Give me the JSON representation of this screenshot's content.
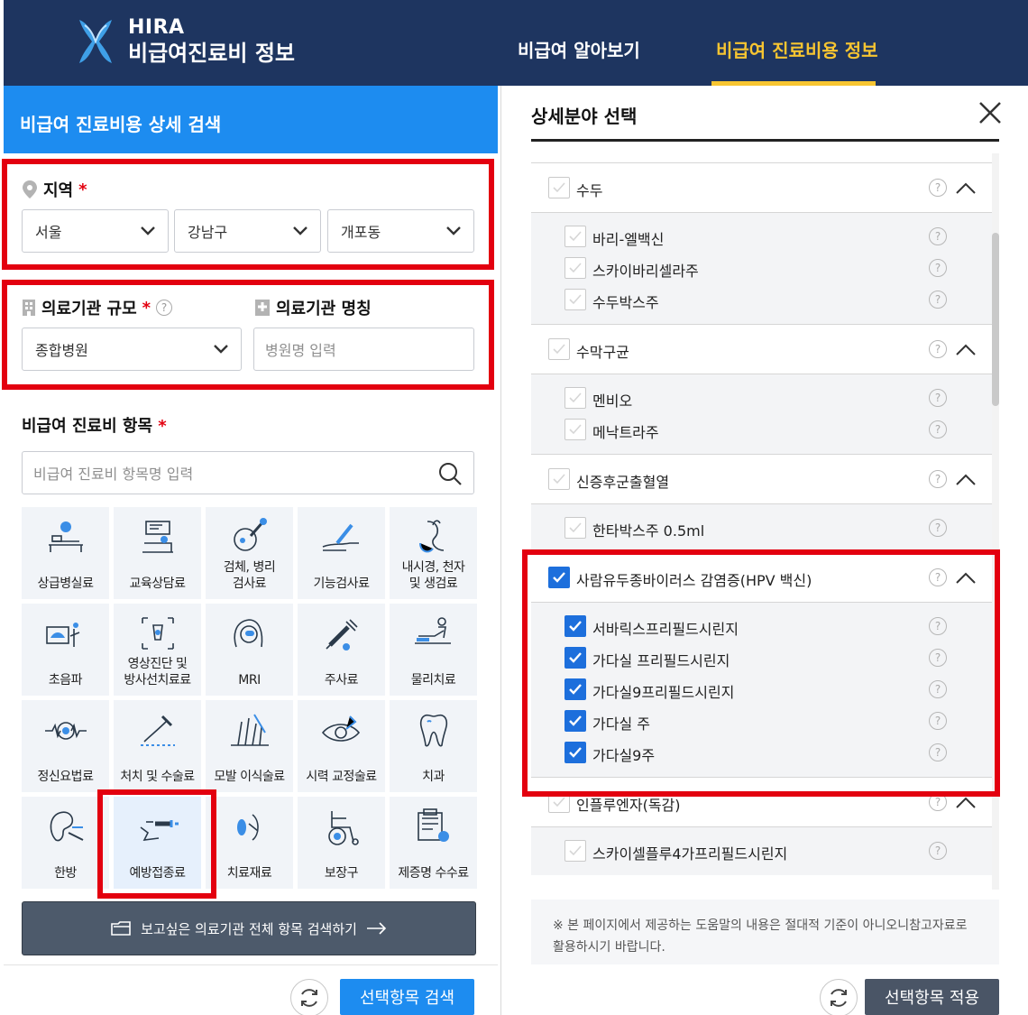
{
  "header": {
    "logo_line1": "HIRA",
    "logo_line2": "비급여진료비 정보",
    "nav": [
      "비급여 알아보기",
      "비급여 진료비용 정보"
    ],
    "bg_color": "#1e3560",
    "active_color": "#f7c531"
  },
  "left": {
    "title": "비급여 진료비용 상세 검색",
    "region": {
      "label": "지역",
      "required": "*",
      "selects": [
        "서울",
        "강남구",
        "개포동"
      ]
    },
    "institution": {
      "size_label": "의료기관 규모",
      "required": "*",
      "size_value": "종합병원",
      "name_label": "의료기관 명칭",
      "name_placeholder": "병원명 입력"
    },
    "items": {
      "label": "비급여 진료비 항목",
      "required": "*",
      "search_placeholder": "비급여 진료비 항목명 입력",
      "tiles": [
        {
          "label": "상급병실료",
          "icon": "hospital-bed-icon"
        },
        {
          "label": "교육상담료",
          "icon": "counseling-icon"
        },
        {
          "label": "검체, 병리\n검사료",
          "icon": "specimen-icon"
        },
        {
          "label": "기능검사료",
          "icon": "function-test-icon"
        },
        {
          "label": "내시경, 천자\n및 생검료",
          "icon": "endoscope-icon"
        },
        {
          "label": "초음파",
          "icon": "ultrasound-icon"
        },
        {
          "label": "영상진단 및\n방사선치료료",
          "icon": "xray-icon"
        },
        {
          "label": "MRI",
          "icon": "mri-icon"
        },
        {
          "label": "주사료",
          "icon": "syringe-icon"
        },
        {
          "label": "물리치료",
          "icon": "physio-icon"
        },
        {
          "label": "정신요법료",
          "icon": "brain-wave-icon"
        },
        {
          "label": "처치 및 수술료",
          "icon": "surgery-icon"
        },
        {
          "label": "모발 이식술료",
          "icon": "hair-transplant-icon"
        },
        {
          "label": "시력 교정술료",
          "icon": "eye-surgery-icon"
        },
        {
          "label": "치과",
          "icon": "tooth-icon"
        },
        {
          "label": "한방",
          "icon": "acupuncture-icon"
        },
        {
          "label": "예방접종료",
          "icon": "vaccine-icon"
        },
        {
          "label": "치료재료",
          "icon": "lens-icon"
        },
        {
          "label": "보장구",
          "icon": "wheelchair-icon"
        },
        {
          "label": "제증명 수수료",
          "icon": "certificate-icon"
        }
      ]
    },
    "full_search_button": "보고싶은 의료기관 전체 항목 검색하기",
    "search_button": "선택항목 검색"
  },
  "right": {
    "title": "상세분야 선택",
    "categories": [
      {
        "label": "수두",
        "checked": false,
        "items": [
          {
            "label": "바리-엘백신",
            "checked": false
          },
          {
            "label": "스카이바리셀라주",
            "checked": false
          },
          {
            "label": "수두박스주",
            "checked": false
          }
        ]
      },
      {
        "label": "수막구균",
        "checked": false,
        "items": [
          {
            "label": "멘비오",
            "checked": false
          },
          {
            "label": "메낙트라주",
            "checked": false
          }
        ]
      },
      {
        "label": "신증후군출혈열",
        "checked": false,
        "items": [
          {
            "label": "한타박스주 0.5ml",
            "checked": false
          }
        ]
      },
      {
        "label": "사람유두종바이러스 감염증(HPV 백신)",
        "checked": true,
        "items": [
          {
            "label": "서바릭스프리필드시린지",
            "checked": true
          },
          {
            "label": "가다실 프리필드시린지",
            "checked": true
          },
          {
            "label": "가다실9프리필드시린지",
            "checked": true
          },
          {
            "label": "가다실 주",
            "checked": true
          },
          {
            "label": "가다실9주",
            "checked": true
          }
        ]
      },
      {
        "label": "인플루엔자(독감)",
        "checked": false,
        "items": [
          {
            "label": "스카이셀플루4가프리필드시린지",
            "checked": false
          }
        ]
      }
    ],
    "notice": "※ 본 페이지에서 제공하는 도움말의 내용은 절대적 기준이 아니오니참고자료로 활용하시기 바랍니다.",
    "apply_button": "선택항목 적용"
  }
}
